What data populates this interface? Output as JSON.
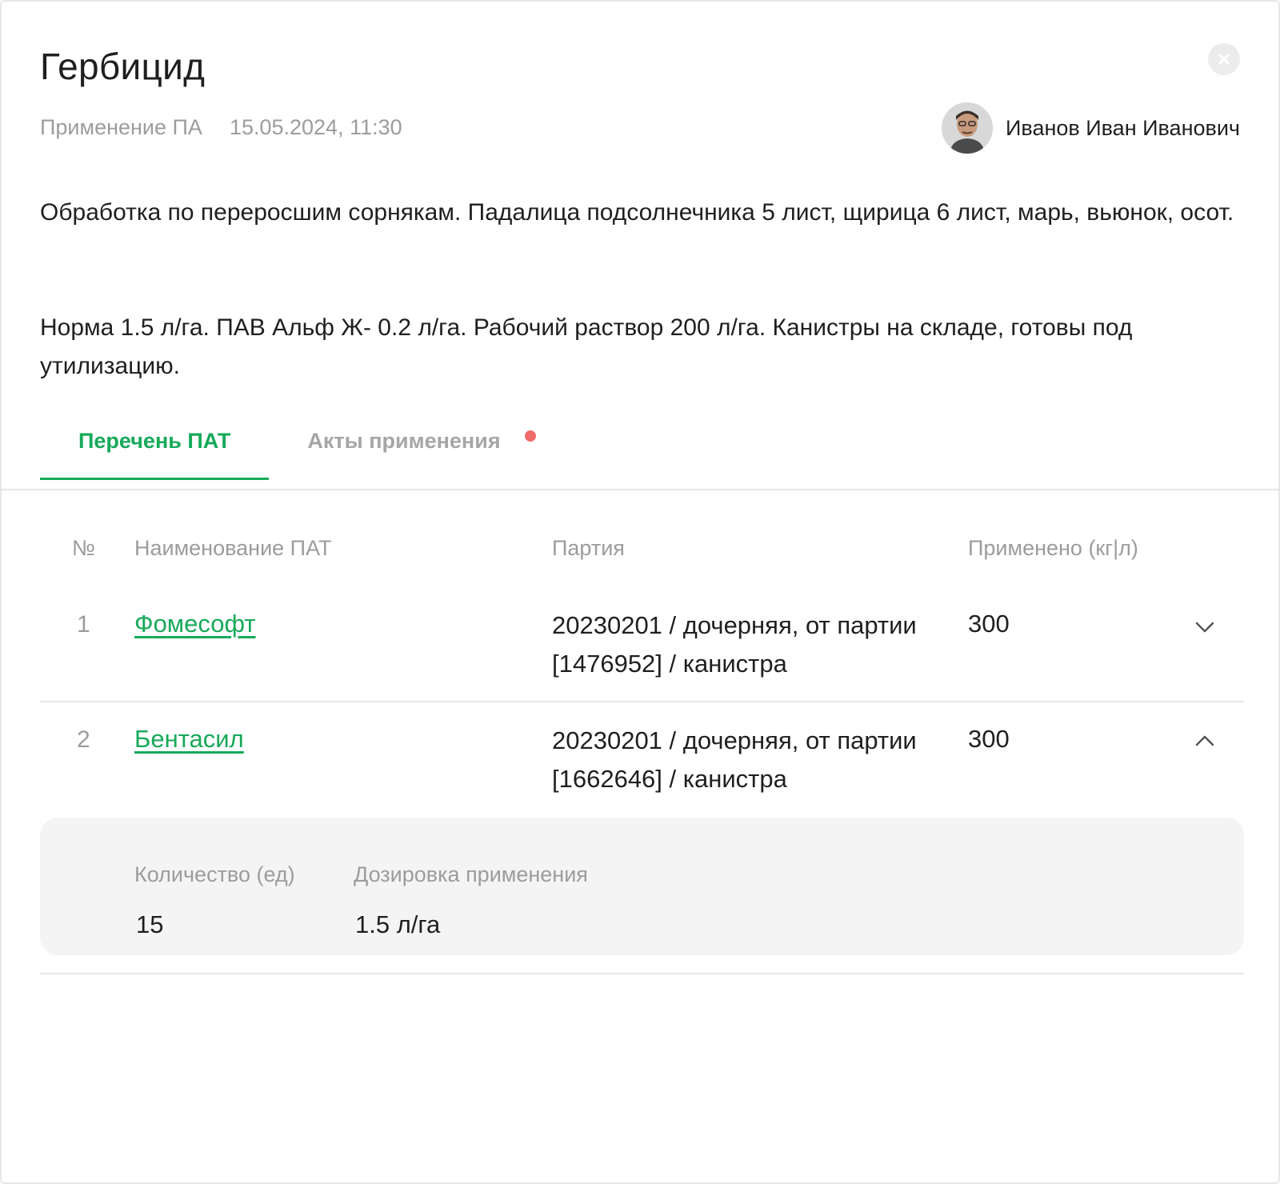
{
  "header": {
    "title": "Гербицид",
    "close_icon": "close-icon",
    "meta_type": "Применение ПА",
    "meta_datetime": "15.05.2024, 11:30",
    "author_name": "Иванов Иван Иванович"
  },
  "description": {
    "paragraph1": "Обработка по переросшим сорнякам. Падалица подсолнечника 5 лист, щирица 6 лист, марь, вьюнок, осот.",
    "paragraph2": "Норма 1.5 л/га. ПАВ Альф Ж- 0.2 л/га. Рабочий раствор 200 л/га. Канистры на складе, готовы под утилизацию."
  },
  "tabs": [
    {
      "label": "Перечень ПАТ",
      "active": true
    },
    {
      "label": "Акты применения",
      "active": false,
      "notification": true
    }
  ],
  "table": {
    "headers": {
      "num": "№",
      "name": "Наименование ПАТ",
      "batch": "Партия",
      "amount": "Применено (кг|л)"
    },
    "rows": [
      {
        "num": "1",
        "name": "Фомесофт",
        "batch": "20230201 / дочерняя, от партии [1476952] / канистра",
        "amount": "300",
        "expanded": false
      },
      {
        "num": "2",
        "name": "Бентасил",
        "batch": "20230201 / дочерняя, от партии [1662646] / канистра",
        "amount": "300",
        "expanded": true,
        "details": {
          "quantity_label": "Количество (ед)",
          "quantity_value": "15",
          "dosage_label": "Дозировка применения",
          "dosage_value": "1.5 л/га"
        }
      }
    ]
  },
  "colors": {
    "accent": "#17a95a",
    "notification": "#f26b6b",
    "muted_text": "#9c9c9c"
  }
}
